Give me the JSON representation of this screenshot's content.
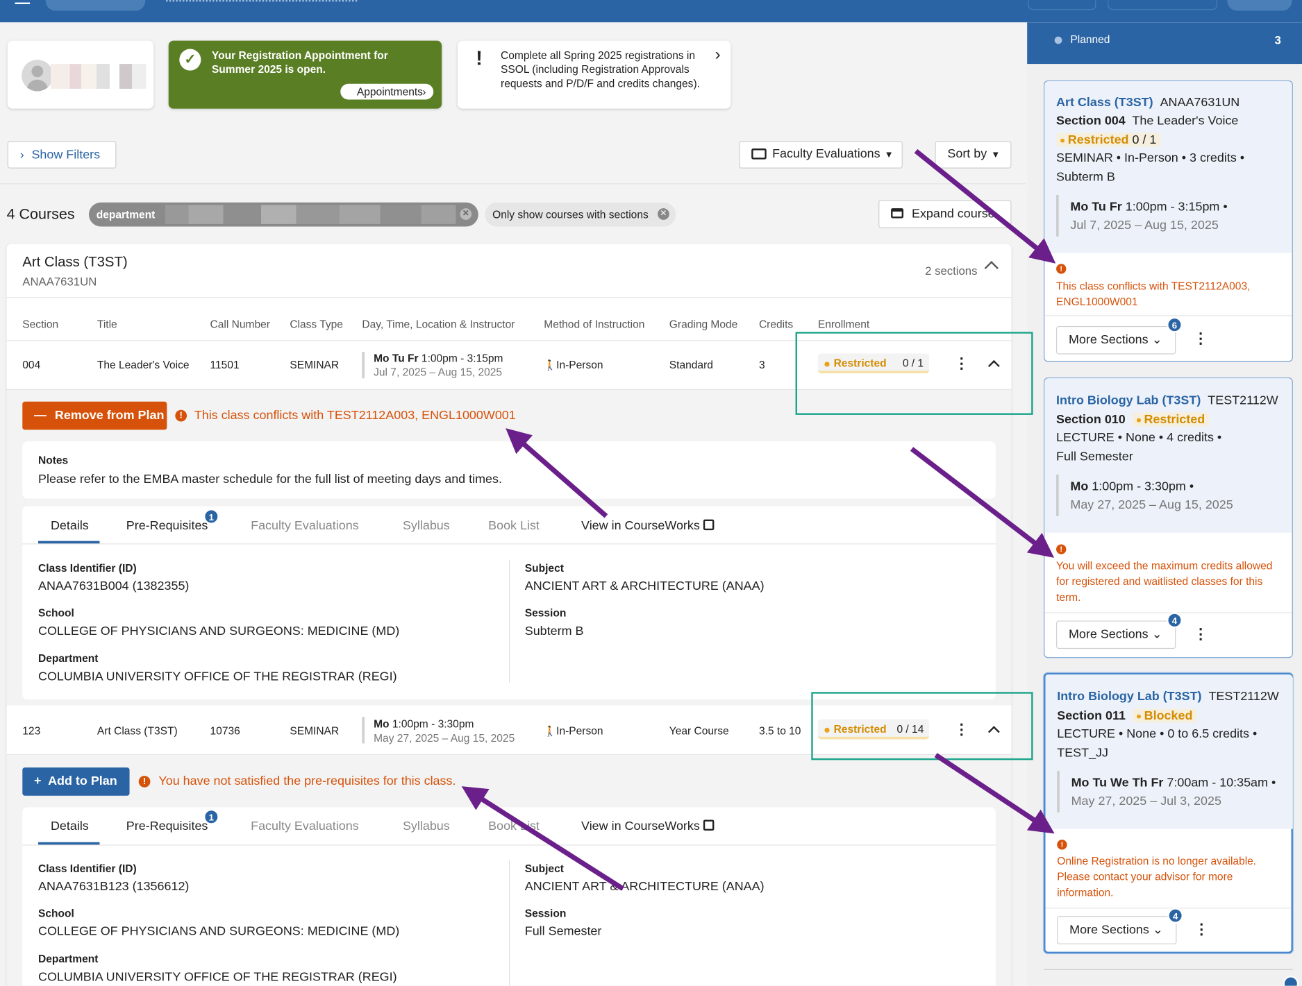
{
  "header": {
    "registration_notice_line1": "Your Registration Appointment for",
    "registration_notice_line2": "Summer 2025 is open.",
    "appointments_button": "Appointments",
    "spring_notice_line1": "Complete all Spring 2025 registrations in",
    "spring_notice_line2": "SSOL (including Registration Approvals",
    "spring_notice_line3": "requests and P/D/F and credits changes)."
  },
  "toolbar": {
    "show_filters": "Show Filters",
    "faculty_evaluations": "Faculty Evaluations",
    "sort_by": "Sort by",
    "course_count": "4 Courses",
    "department_chip": "department",
    "sections_chip": "Only show courses with sections",
    "expand_courses": "Expand course"
  },
  "course": {
    "title": "Art Class (T3ST)",
    "code": "ANAA7631UN",
    "sections_count": "2 sections",
    "columns": [
      "Section",
      "Title",
      "Call Number",
      "Class Type",
      "Day, Time, Location & Instructor",
      "Method of Instruction",
      "Grading Mode",
      "Credits",
      "Enrollment"
    ],
    "sections": [
      {
        "section": "004",
        "title": "The Leader's Voice",
        "call_number": "11501",
        "class_type": "SEMINAR",
        "days": "Mo Tu Fr",
        "time": "1:00pm - 3:15pm",
        "dates": "Jul 7, 2025 – Aug 15, 2025",
        "method": "In-Person",
        "grading": "Standard",
        "credits": "3",
        "status": "Restricted",
        "enrollment": "0 / 1",
        "action_label": "Remove from Plan",
        "warning": "This class conflicts with TEST2112A003, ENGL1000W001",
        "notes_label": "Notes",
        "notes_text": "Please refer to the EMBA master schedule for the full list of meeting days and times.",
        "tabs": [
          "Details",
          "Pre-Requisites",
          "Faculty Evaluations",
          "Syllabus",
          "Book List",
          "View in CourseWorks"
        ],
        "prereq_count": "1",
        "details": {
          "id_label": "Class Identifier (ID)",
          "id_value": "ANAA7631B004 (1382355)",
          "school_label": "School",
          "school_value": "COLLEGE OF PHYSICIANS AND SURGEONS: MEDICINE (MD)",
          "dept_label": "Department",
          "dept_value": "COLUMBIA UNIVERSITY OFFICE OF THE REGISTRAR (REGI)",
          "subject_label": "Subject",
          "subject_value": "ANCIENT ART & ARCHITECTURE (ANAA)",
          "session_label": "Session",
          "session_value": "Subterm B"
        }
      },
      {
        "section": "123",
        "title": "Art Class (T3ST)",
        "call_number": "10736",
        "class_type": "SEMINAR",
        "days": "Mo",
        "time": "1:00pm - 3:30pm",
        "dates": "May 27, 2025 – Aug 15, 2025",
        "method": "In-Person",
        "grading": "Year Course",
        "credits": "3.5 to 10",
        "status": "Restricted",
        "enrollment": "0 / 14",
        "action_label": "Add to Plan",
        "warning": "You have not satisfied the pre-requisites for this class.",
        "tabs": [
          "Details",
          "Pre-Requisites",
          "Faculty Evaluations",
          "Syllabus",
          "Book List",
          "View in CourseWorks"
        ],
        "prereq_count": "1",
        "details": {
          "id_label": "Class Identifier (ID)",
          "id_value": "ANAA7631B123 (1356612)",
          "school_label": "School",
          "school_value": "COLLEGE OF PHYSICIANS AND SURGEONS: MEDICINE (MD)",
          "dept_label": "Department",
          "dept_value": "COLUMBIA UNIVERSITY OFFICE OF THE REGISTRAR (REGI)",
          "subject_label": "Subject",
          "subject_value": "ANCIENT ART & ARCHITECTURE (ANAA)",
          "session_label": "Session",
          "session_value": "Full Semester"
        }
      }
    ]
  },
  "sidebar": {
    "planned_label": "Planned",
    "planned_count": "3",
    "cards": [
      {
        "course": "Art Class (T3ST)",
        "code": "ANAA7631UN",
        "section": "Section 004",
        "section_title": "The Leader's Voice",
        "status": "Restricted",
        "enrollment": "0 / 1",
        "meta": "SEMINAR • In-Person • 3 credits •",
        "term": "Subterm B",
        "days": "Mo Tu Fr",
        "time": "1:00pm - 3:15pm •",
        "dates": "Jul 7, 2025 – Aug 15, 2025",
        "warning": "This class conflicts with TEST2112A003, ENGL1000W001",
        "more_sections": "More Sections",
        "more_count": "6"
      },
      {
        "course": "Intro Biology Lab (T3ST)",
        "code": "TEST2112W",
        "section": "Section 010",
        "status": "Restricted",
        "meta": "LECTURE • None • 4 credits •",
        "term": "Full Semester",
        "days": "Mo",
        "time": "1:00pm - 3:30pm •",
        "dates": "May 27, 2025 – Aug 15, 2025",
        "warning": "You will exceed the maximum credits allowed for registered and waitlisted classes for this term.",
        "more_sections": "More Sections",
        "more_count": "4"
      },
      {
        "course": "Intro Biology Lab (T3ST)",
        "code": "TEST2112W",
        "section": "Section 011",
        "status": "Blocked",
        "meta": "LECTURE • None • 0 to 6.5 credits •",
        "term": "TEST_JJ",
        "days": "Mo Tu We Th Fr",
        "time": "7:00am - 10:35am •",
        "dates": "May 27, 2025 – Jul 3, 2025",
        "warning": "Online Registration is no longer available. Please contact your advisor for more information.",
        "more_sections": "More Sections",
        "more_count": "4"
      }
    ]
  },
  "colors": {
    "brand_blue": "#2a64a4",
    "warning_orange": "#d6520a",
    "restricted_amber": "#d48c00",
    "success_green": "#5a7e23",
    "annotation_purple": "#6a1f8a",
    "annotation_teal": "#1aa38a"
  }
}
